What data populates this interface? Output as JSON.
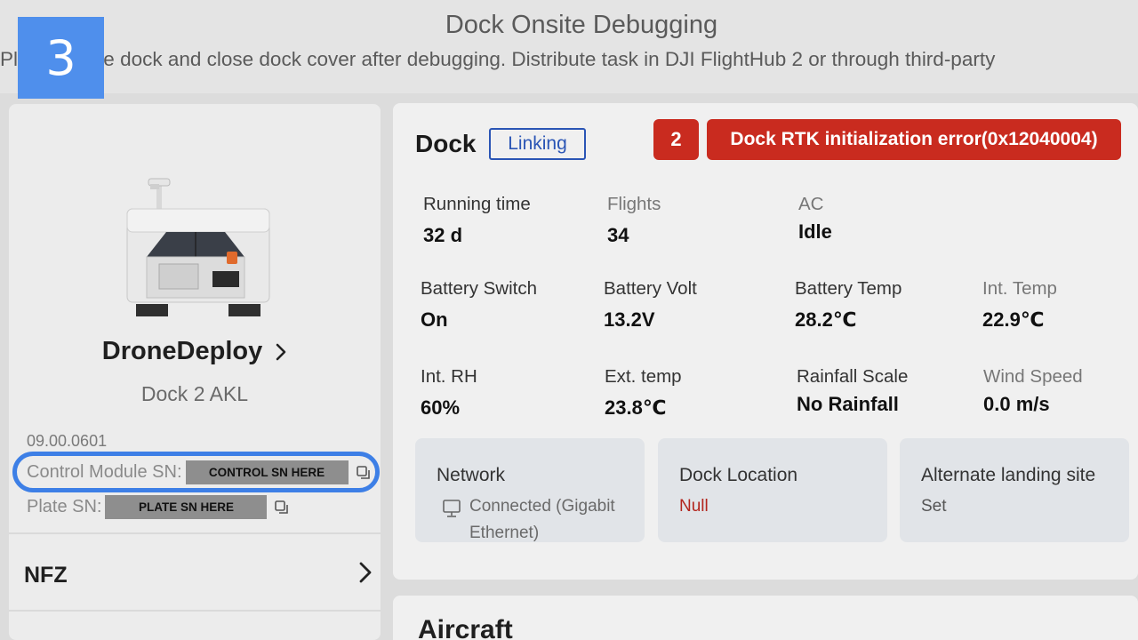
{
  "header": {
    "title": "Dock Onsite Debugging",
    "subtitle": "Pla   aft inside dock and close dock cover after debugging. Distribute task in DJI FlightHub 2 or through third-party",
    "step_badge": "3"
  },
  "device": {
    "name": "DroneDeploy",
    "model": "Dock 2 AKL",
    "firmware": "09.00.0601",
    "control_sn_label": "Control Module SN:",
    "control_sn_value": "CONTROL SN HERE",
    "plate_sn_label": "Plate SN:",
    "plate_sn_value": "PLATE SN HERE"
  },
  "nav": {
    "nfz_label": "NFZ"
  },
  "dock": {
    "title": "Dock",
    "status": "Linking",
    "error_count": "2",
    "error_text": "Dock RTK initialization error(0x12040004)"
  },
  "metrics": [
    {
      "label": "Running time",
      "value": "32 d"
    },
    {
      "label": "Flights",
      "value": "34"
    },
    {
      "label": "AC",
      "value": "Idle"
    },
    {
      "label": "Battery Switch",
      "value": "On"
    },
    {
      "label": "Battery Volt",
      "value": "13.2V"
    },
    {
      "label": "Battery Temp",
      "value": "28.2℃"
    },
    {
      "label": "Int. Temp",
      "value": "22.9℃"
    },
    {
      "label": "Int. RH",
      "value": "60%"
    },
    {
      "label": "Ext. temp",
      "value": "23.8℃"
    },
    {
      "label": "Rainfall Scale",
      "value": "No Rainfall"
    },
    {
      "label": "Wind Speed",
      "value": "0.0 m/s"
    }
  ],
  "cards": {
    "network": {
      "title": "Network",
      "value": "Connected (Gigabit Ethernet)",
      "icon": "network-icon"
    },
    "location": {
      "title": "Dock Location",
      "value": "Null"
    },
    "landing": {
      "title": "Alternate landing site",
      "value": "Set"
    }
  },
  "colors": {
    "accent_blue": "#3d7fe6",
    "error_red": "#c92b1f",
    "status_blue": "#2a55b5"
  },
  "next_section": {
    "title": "Aircraft"
  }
}
